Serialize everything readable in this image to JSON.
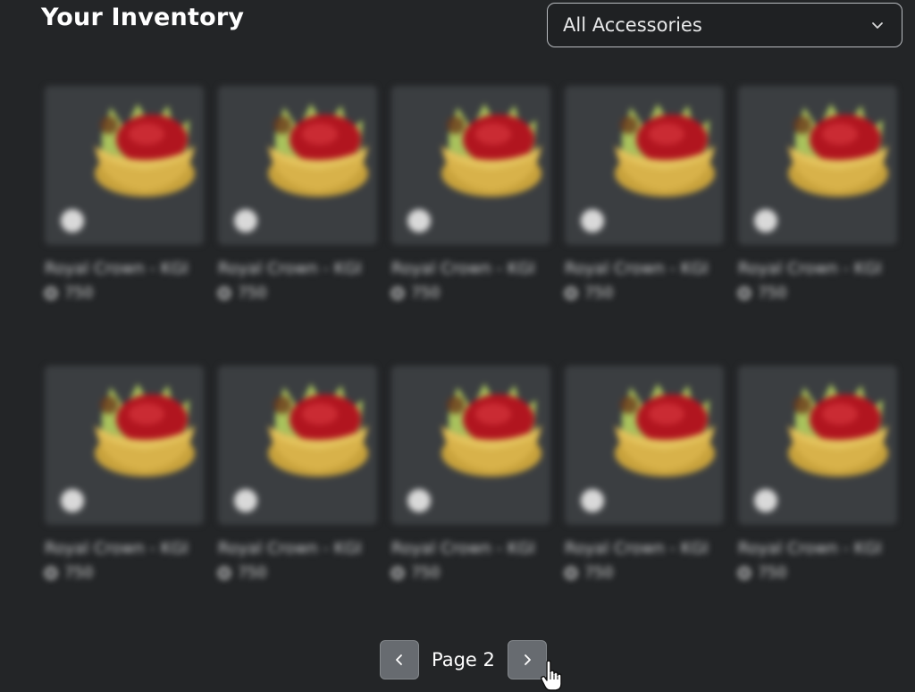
{
  "header": {
    "title": "Your Inventory"
  },
  "filter": {
    "selected": "All Accessories"
  },
  "items": [
    {
      "name": "Royal Crown - KGI",
      "price": "750"
    },
    {
      "name": "Royal Crown - KGI",
      "price": "750"
    },
    {
      "name": "Royal Crown - KGI",
      "price": "750"
    },
    {
      "name": "Royal Crown - KGI",
      "price": "750"
    },
    {
      "name": "Royal Crown - KGI",
      "price": "750"
    },
    {
      "name": "Royal Crown - KGI",
      "price": "750"
    },
    {
      "name": "Royal Crown - KGI",
      "price": "750"
    },
    {
      "name": "Royal Crown - KGI",
      "price": "750"
    },
    {
      "name": "Royal Crown - KGI",
      "price": "750"
    },
    {
      "name": "Royal Crown - KGI",
      "price": "750"
    }
  ],
  "pagination": {
    "label": "Page 2"
  },
  "icons": {
    "dropdown": "chevron-down-icon",
    "prev": "chevron-left-icon",
    "next": "chevron-right-icon",
    "currency": "robux-icon",
    "cursor": "hand-pointer-icon"
  },
  "colors": {
    "background": "#232527",
    "card": "#3b3e41",
    "button": "#676b70"
  }
}
